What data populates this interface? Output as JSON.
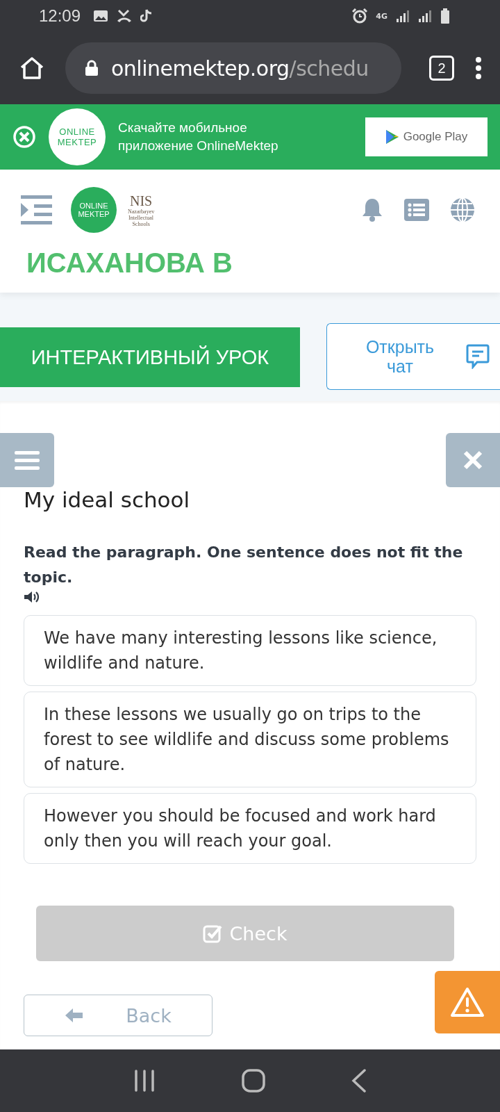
{
  "status_bar": {
    "time": "12:09",
    "network": "4G"
  },
  "browser": {
    "url_host": "onlinemektep.org",
    "url_path": "/schedu",
    "tab_count": "2"
  },
  "app_banner": {
    "logo_lines": [
      "ONLINE",
      "MEKTEP"
    ],
    "text": "Скачайте мобильное приложение OnlineMektep",
    "store_button": "Google Play"
  },
  "header": {
    "logo_lines": [
      "ONLINE",
      "MEKTEP"
    ],
    "partner_logo": {
      "title": "NIS",
      "lines": [
        "Nazarbayev",
        "Intellectual",
        "Schools"
      ]
    },
    "user_name": "ИСАХАНОВА В"
  },
  "lesson_bar": {
    "lesson_button": "ИНТЕРАКТИВНЫЙ УРОК",
    "chat_button": "Открыть чат"
  },
  "task": {
    "title": "My ideal school",
    "instruction": "Read the paragraph. One sentence does not fit the topic.",
    "sentences": [
      {
        "text": "We have many interesting lessons like science, wildlife and nature."
      },
      {
        "text": "In these lessons we usually go on trips to the forest to see wildlife and discuss some problems of nature."
      },
      {
        "text": "However you should be focused and work hard only then you will reach your goal."
      }
    ],
    "check_button": {
      "label": "Check",
      "disabled": true
    },
    "back_button": "Back"
  }
}
